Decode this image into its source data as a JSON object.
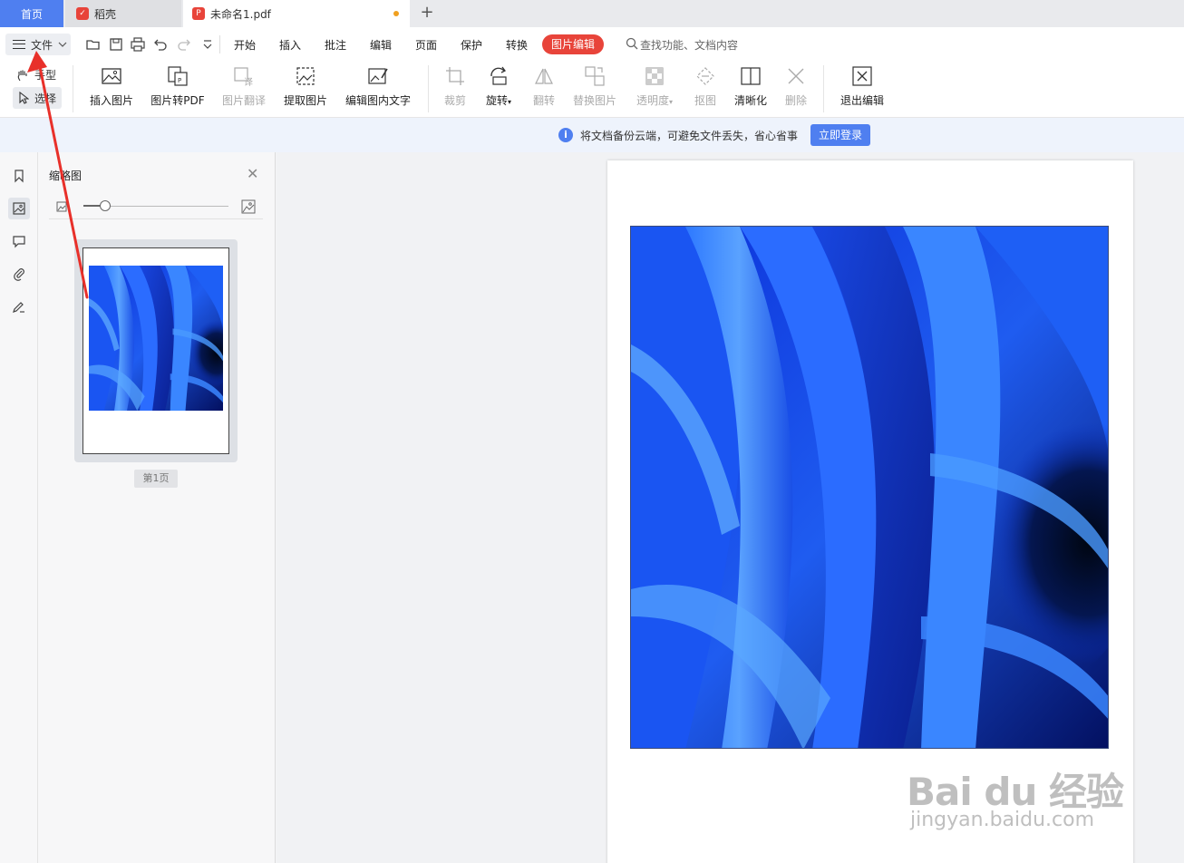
{
  "tabs": {
    "home": "首页",
    "daoke": "稻壳",
    "doc": "未命名1.pdf",
    "add": "+"
  },
  "menu": {
    "file": "文件",
    "items": [
      "开始",
      "插入",
      "批注",
      "编辑",
      "页面",
      "保护",
      "转换"
    ],
    "active": "图片编辑",
    "search": "查找功能、文档内容"
  },
  "ribbon": {
    "hand": "手型",
    "select": "选择",
    "insert_image": "插入图片",
    "image_to_pdf": "图片转PDF",
    "image_translate": "图片翻译",
    "extract_image": "提取图片",
    "edit_text_in_image": "编辑图内文字",
    "crop": "裁剪",
    "rotate": "旋转",
    "flip": "翻转",
    "replace_image": "替换图片",
    "transparency": "透明度",
    "cutout": "抠图",
    "sharpen": "清晰化",
    "delete": "删除",
    "exit_edit": "退出编辑"
  },
  "notice": {
    "text": "将文档备份云端，可避免文件丢失，省心省事",
    "button": "立即登录"
  },
  "thumbnails": {
    "title": "缩略图",
    "page_label": "第1页",
    "zoom_level": 0.15
  },
  "watermark": {
    "main": "Bai du 经验",
    "sub": "jingyan.baidu.com"
  },
  "colors": {
    "accent": "#4f7ff0",
    "active_tab": "#e8443a",
    "annotation_arrow": "#e8302a"
  }
}
